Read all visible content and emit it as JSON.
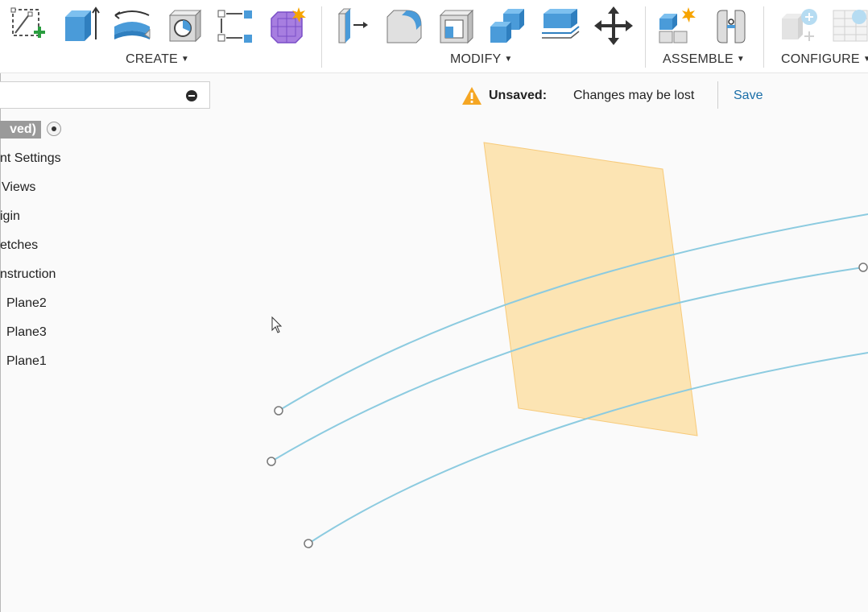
{
  "toolbar": {
    "groups": [
      {
        "label": "CREATE"
      },
      {
        "label": "MODIFY"
      },
      {
        "label": "ASSEMBLE"
      },
      {
        "label": "CONFIGURE"
      }
    ]
  },
  "browser": {
    "document_title": "ved)",
    "items": [
      {
        "label": "nt Settings"
      },
      {
        "label": "Views"
      },
      {
        "label": "igin"
      },
      {
        "label": "etches"
      },
      {
        "label": "nstruction"
      },
      {
        "label": "Plane2"
      },
      {
        "label": "Plane3"
      },
      {
        "label": "Plane1"
      }
    ]
  },
  "status": {
    "unsaved_label": "Unsaved:",
    "message": "Changes may be lost",
    "save_label": "Save"
  },
  "colors": {
    "plane_fill": "#fde3b0",
    "plane_stroke": "#f7c874",
    "sketch_curve": "#8ccbe0",
    "accent_blue": "#4a9bd9",
    "warning": "#f5a623",
    "link": "#1a6ea8"
  }
}
